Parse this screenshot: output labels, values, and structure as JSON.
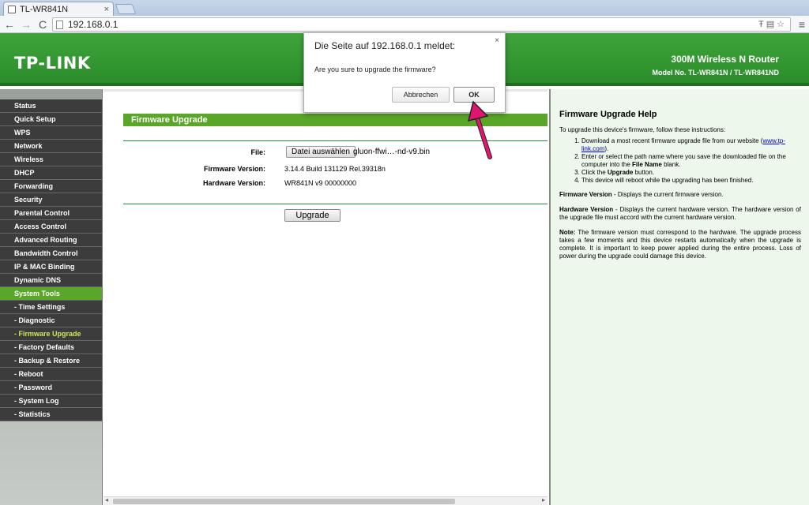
{
  "browser": {
    "tab_title": "TL-WR841N",
    "url": "192.168.0.1"
  },
  "header": {
    "logo": "TP-LINK",
    "product_name": "300M Wireless N Router",
    "model": "Model No. TL-WR841N / TL-WR841ND"
  },
  "sidebar": {
    "items": [
      {
        "label": "Status"
      },
      {
        "label": "Quick Setup"
      },
      {
        "label": "WPS"
      },
      {
        "label": "Network"
      },
      {
        "label": "Wireless"
      },
      {
        "label": "DHCP"
      },
      {
        "label": "Forwarding"
      },
      {
        "label": "Security"
      },
      {
        "label": "Parental Control"
      },
      {
        "label": "Access Control"
      },
      {
        "label": "Advanced Routing"
      },
      {
        "label": "Bandwidth Control"
      },
      {
        "label": "IP & MAC Binding"
      },
      {
        "label": "Dynamic DNS"
      },
      {
        "label": "System Tools"
      },
      {
        "label": "- Time Settings"
      },
      {
        "label": "- Diagnostic"
      },
      {
        "label": "- Firmware Upgrade"
      },
      {
        "label": "- Factory Defaults"
      },
      {
        "label": "- Backup & Restore"
      },
      {
        "label": "- Reboot"
      },
      {
        "label": "- Password"
      },
      {
        "label": "- System Log"
      },
      {
        "label": "- Statistics"
      }
    ]
  },
  "main": {
    "section_title": "Firmware Upgrade",
    "file_label": "File:",
    "file_button": "Datei auswählen",
    "file_name": "gluon-ffwi…-nd-v9.bin",
    "firmware_label": "Firmware Version:",
    "firmware_value": "3.14.4 Build 131129 Rel.39318n",
    "hardware_label": "Hardware Version:",
    "hardware_value": "WR841N v9 00000000",
    "upgrade_button": "Upgrade"
  },
  "help": {
    "title": "Firmware Upgrade Help",
    "intro": "To upgrade this device's firmware, follow these instructions:",
    "step1_pre": "Download a most recent firmware upgrade file from our website (",
    "step1_link": "www.tp-link.com",
    "step1_post": ").",
    "step2_pre": "Enter or select the path name where you save the downloaded file on the computer into the ",
    "step2_bold": "File Name",
    "step2_post": " blank.",
    "step3_pre": "Click the ",
    "step3_bold": "Upgrade",
    "step3_post": " button.",
    "step4": "This device will reboot while the upgrading has been finished.",
    "fw_bold": "Firmware Version",
    "fw_text": " - Displays the current firmware version.",
    "hw_bold": "Hardware Version",
    "hw_text": " - Displays the current hardware version. The hardware version of the upgrade file must accord with the current hardware version.",
    "note_bold": "Note:",
    "note_text": " The firmware version must correspond to the hardware. The upgrade process takes a few moments and this device restarts automatically when the upgrade is complete. It is important to keep power applied during the entire process. Loss of power during the upgrade could damage this device."
  },
  "dialog": {
    "title": "Die Seite auf 192.168.0.1 meldet:",
    "message": "Are you sure to upgrade the firmware?",
    "cancel": "Abbrechen",
    "ok": "OK"
  },
  "colors": {
    "brand_green": "#5aa628",
    "arrow": "#e0156f"
  }
}
